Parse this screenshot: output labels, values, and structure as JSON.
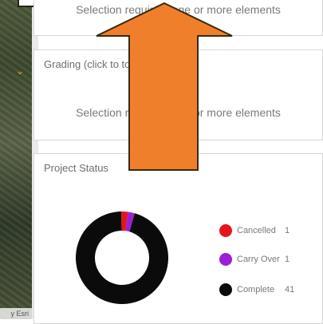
{
  "panels": [
    {
      "title": "",
      "message": "Selection required: one or more elements"
    },
    {
      "title": "Grading (click to toggle overlap)",
      "message": "Selection required: one or more elements"
    },
    {
      "title": "Project Status"
    }
  ],
  "map": {
    "attribution": "y Esri"
  },
  "chart_data": {
    "type": "pie",
    "title": "Project Status",
    "categories": [
      "Cancelled",
      "Carry Over",
      "Complete"
    ],
    "values": [
      1,
      1,
      41
    ],
    "colors": [
      "#e8141c",
      "#9b1fd6",
      "#0b0b0b"
    ]
  },
  "overlay": {
    "arrow_color": "#f07f2c",
    "arrow_direction": "up"
  }
}
